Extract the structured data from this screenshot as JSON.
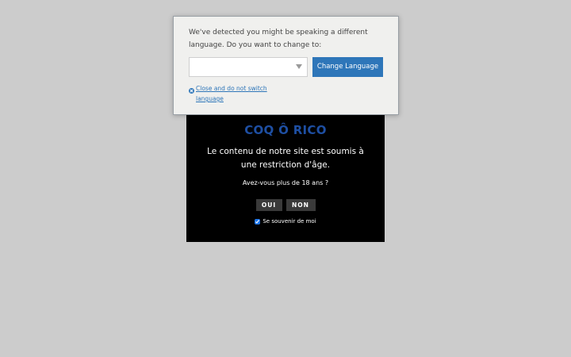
{
  "colors": {
    "page_background": "#cccccc",
    "brand_blue": "#1e4fa3",
    "button_blue": "#2e76b9",
    "age_gate_background": "#000000",
    "age_button_background": "#3a3a3a"
  },
  "language_dialog": {
    "message": "We've detected you might be speaking a different language. Do you want to change to:",
    "select_value": "",
    "change_button_label": "Change Language",
    "close_link_label": "Close and do not switch language",
    "close_icon": "close-circle-icon",
    "caret_icon": "chevron-down-icon"
  },
  "age_gate": {
    "brand": "COQ Ô RICO",
    "message": "Le contenu de notre site est soumis à une restriction d'âge.",
    "question": "Avez-vous plus de 18 ans ?",
    "yes_label": "OUI",
    "no_label": "NON",
    "remember_label": "Se souvenir de moi",
    "remember_checked": true
  }
}
